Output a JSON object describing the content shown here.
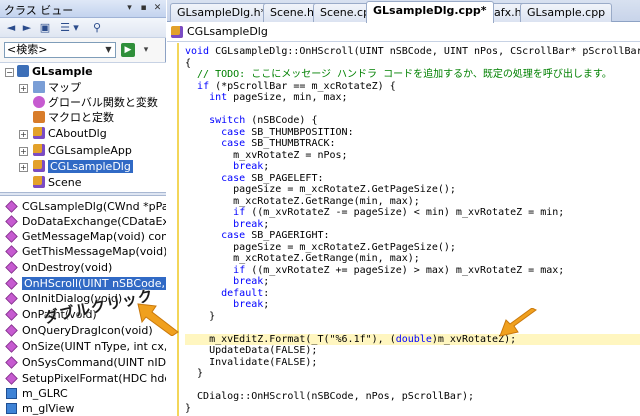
{
  "left_pane": {
    "title": "クラス ビュー",
    "title_buttons": [
      "▾",
      "▪",
      "✕"
    ],
    "search": {
      "value": "<検索>"
    },
    "tree": [
      {
        "label": "GLsample",
        "icon": "project-icon"
      },
      {
        "label": "マップ",
        "icon": "map-icon"
      },
      {
        "label": "グローバル関数と変数",
        "icon": "global-icon"
      },
      {
        "label": "マクロと定数",
        "icon": "macro-icon"
      },
      {
        "label": "CAboutDlg",
        "icon": "class-icon"
      },
      {
        "label": "CGLsampleApp",
        "icon": "class-icon"
      },
      {
        "label": "CGLsampleDlg",
        "icon": "class-icon"
      },
      {
        "label": "Scene",
        "icon": "class-icon"
      }
    ],
    "members": [
      "CGLsampleDlg(CWnd *pPar",
      "DoDataExchange(CDataExc",
      "GetMessageMap(void) cons",
      "GetThisMessageMap(void)",
      "OnDestroy(void)",
      "OnHScroll(UINT nSBCode, U",
      "OnInitDialog(void)",
      "OnPaint(void)",
      "OnQueryDragIcon(void)",
      "OnSize(UINT nType, int cx,",
      "OnSysCommand(UINT nID,",
      "SetupPixelFormat(HDC hdc)",
      "m_GLRC",
      "m_glView"
    ]
  },
  "tabs": [
    {
      "label": "GLsampleDlg.h*"
    },
    {
      "label": "Scene.h"
    },
    {
      "label": "Scene.cpp"
    },
    {
      "label": "GLsampleDlg.cpp*"
    },
    {
      "label": "stdafx.h"
    },
    {
      "label": "GLsample.cpp"
    }
  ],
  "breadcrumb": "CGLsampleDlg",
  "code_lines": [
    "void CGLsampleDlg::OnHScroll(UINT nSBCode, UINT nPos, CScrollBar* pScrollBar)",
    "{",
    "  // TODO: ここにメッセージ ハンドラ コードを追加するか、既定の処理を呼び出します。",
    "  if (*pScrollBar == m_xcRotateZ) {",
    "    int pageSize, min, max;",
    "",
    "    switch (nSBCode) {",
    "      case SB_THUMBPOSITION:",
    "      case SB_THUMBTRACK:",
    "        m_xvRotateZ = nPos;",
    "        break;",
    "      case SB_PAGELEFT:",
    "        pageSize = m_xcRotateZ.GetPageSize();",
    "        m_xcRotateZ.GetRange(min, max);",
    "        if ((m_xvRotateZ -= pageSize) < min) m_xvRotateZ = min;",
    "        break;",
    "      case SB_PAGERIGHT:",
    "        pageSize = m_xcRotateZ.GetPageSize();",
    "        m_xcRotateZ.GetRange(min, max);",
    "        if ((m_xvRotateZ += pageSize) > max) m_xvRotateZ = max;",
    "        break;",
    "      default:",
    "        break;",
    "    }",
    "",
    "    m_xvEditZ.Format(_T(\"%6.1f\"), (double)m_xvRotateZ);",
    "    UpdateData(FALSE);",
    "    Invalidate(FALSE);",
    "  }",
    "",
    "  CDialog::OnHScroll(nSBCode, nPos, pScrollBar);",
    "}"
  ],
  "annotation": "ダブルクリック",
  "colors": {
    "selection": "#316ac5",
    "keyword": "#0000ff",
    "comment": "#008000",
    "arrow": "#f0a01e",
    "current_line": "#fff6c0"
  }
}
